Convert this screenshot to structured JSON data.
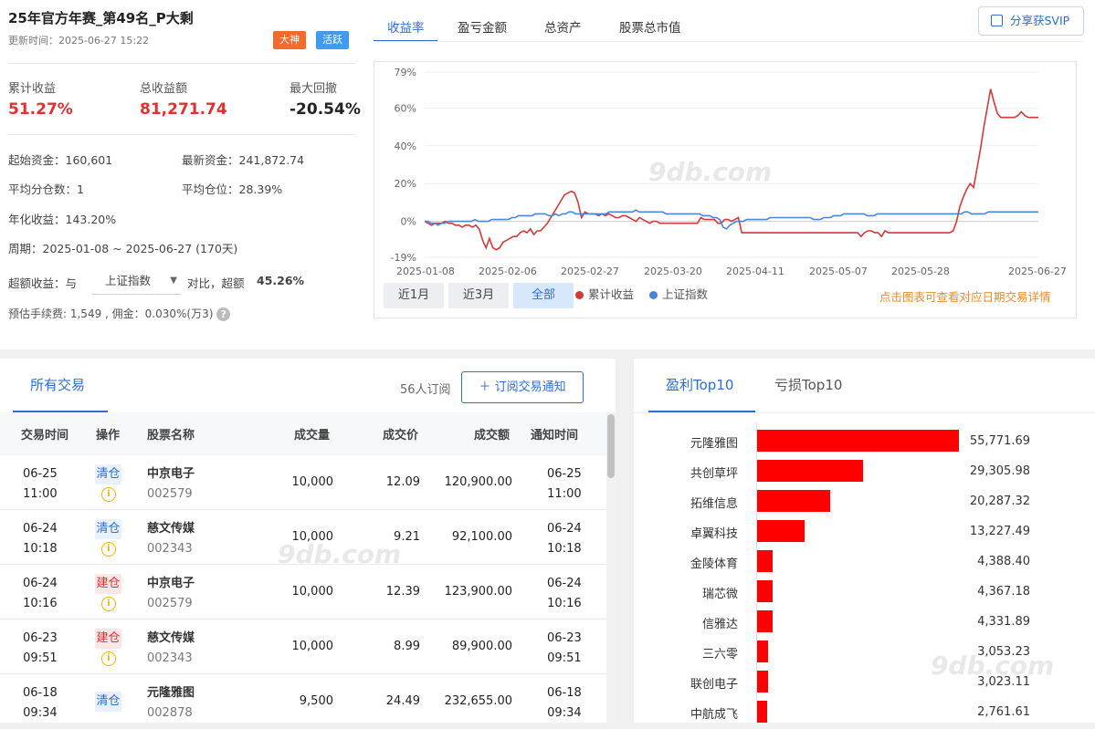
{
  "header": {
    "title": "25年官方年赛_第49名_P大剩",
    "updated": "更新时间：2025-06-27 15:22",
    "badges": [
      "大神",
      "活跃"
    ]
  },
  "stats": [
    {
      "label": "累计收益",
      "value": "51.27%"
    },
    {
      "label": "总收益额",
      "value": "81,271.74"
    },
    {
      "label": "最大回撤",
      "value": "-20.54%"
    }
  ],
  "info": {
    "start_capital": "起始资金：160,601",
    "latest_capital": "最新资金：241,872.74",
    "avg_split": "平均分仓数：1",
    "avg_position": "平均仓位：28.39%",
    "annual": "年化收益：143.20%",
    "period": "周期：2025-01-08 ~ 2025-06-27 (170天)",
    "excess_prefix": "超额收益：与",
    "excess_select": "上证指数",
    "excess_mid": "对比，超额",
    "excess_value": "45.26%",
    "fee": "预估手续费: 1,549 , 佣金：0.030%(万3)"
  },
  "chart_tabs": [
    "收益率",
    "盈亏金额",
    "总资产",
    "股票总市值"
  ],
  "share_label": "分享获SVIP",
  "range_buttons": [
    "近1月",
    "近3月",
    "全部"
  ],
  "legend": [
    "累计收益",
    "上证指数"
  ],
  "hint": "点击图表可查看对应日期交易详情",
  "watermark": "9db.com",
  "colors": {
    "series_return": "#d23a3a",
    "series_index": "#4a86d6",
    "accent": "#2d6dd4",
    "bar": "#ff0000"
  },
  "chart_data": {
    "type": "line",
    "x_ticks": [
      "2025-01-08",
      "2025-02-06",
      "2025-02-27",
      "2025-03-20",
      "2025-04-11",
      "2025-05-07",
      "2025-05-28",
      "2025-06-27"
    ],
    "y_ticks": [
      "79%",
      "60%",
      "40%",
      "20%",
      "0%",
      "-19%"
    ],
    "ylim": [
      -19,
      79
    ],
    "grid": "horizontal",
    "series": [
      {
        "name": "累计收益",
        "values": [
          0,
          -1,
          -2,
          -1,
          -1,
          -1,
          0,
          -1,
          -1,
          -2,
          -2,
          -3,
          -2,
          -2,
          -3,
          -2,
          -4,
          -10,
          -14,
          -9,
          -14,
          -15,
          -14,
          -11,
          -10,
          -9,
          -8,
          -8,
          -6,
          -5,
          -6,
          -4,
          -7,
          -5,
          -5,
          -3,
          -1,
          2,
          5,
          8,
          11,
          14,
          15,
          16,
          15,
          10,
          2,
          5,
          4,
          4,
          4,
          3,
          4,
          3,
          4,
          3,
          2,
          2,
          3,
          3,
          2,
          1,
          0,
          2,
          1,
          0,
          -1,
          0,
          0,
          -1,
          -1,
          -1,
          -1,
          -1,
          -1,
          -1,
          -1,
          -1,
          -1,
          -1,
          -1,
          2,
          1,
          1,
          1,
          1,
          -1,
          -1,
          1,
          1,
          0,
          1,
          2,
          -6,
          -6,
          -6,
          -6,
          -6,
          -6,
          -6,
          -6,
          -6,
          -6,
          -6,
          -6,
          -6,
          -6,
          -6,
          -6,
          -6,
          -6,
          -6,
          -6,
          -6,
          -6,
          -6,
          -6,
          -6,
          -6,
          -6,
          -6,
          -6,
          -6,
          -6,
          -6,
          -6,
          -6,
          -6,
          -8,
          -6,
          -5,
          -5,
          -6,
          -6,
          -8,
          -5,
          -6,
          -6,
          -6,
          -6,
          -6,
          -6,
          -6,
          -6,
          -6,
          -6,
          -6,
          -6,
          -6,
          -6,
          -6,
          -6,
          -6,
          -6,
          -6,
          -5,
          0,
          8,
          13,
          17,
          20,
          18,
          28,
          38,
          50,
          60,
          70,
          63,
          57,
          55,
          55,
          55,
          55,
          55,
          56,
          58,
          56,
          55,
          55,
          55,
          55
        ]
      },
      {
        "name": "上证指数",
        "values": [
          0,
          0,
          -1,
          -1,
          -2,
          -1,
          -1,
          0,
          0,
          0,
          0,
          0,
          0,
          0,
          0,
          1,
          0,
          0,
          0,
          0,
          1,
          1,
          1,
          1,
          1,
          1,
          2,
          2,
          3,
          3,
          3,
          3,
          3,
          4,
          4,
          4,
          4,
          3,
          3,
          4,
          3,
          4,
          4,
          5,
          5,
          4,
          4,
          4,
          4,
          4,
          4,
          4,
          4,
          4,
          4,
          5,
          5,
          5,
          5,
          5,
          5,
          5,
          5,
          6,
          5,
          5,
          5,
          5,
          5,
          5,
          5,
          5,
          4,
          4,
          4,
          4,
          4,
          4,
          4,
          4,
          4,
          4,
          4,
          3,
          3,
          3,
          2,
          2,
          1,
          -3,
          -4,
          -2,
          -1,
          0,
          0,
          0,
          1,
          1,
          1,
          1,
          1,
          1,
          1,
          2,
          2,
          2,
          2,
          2,
          2,
          2,
          2,
          2,
          2,
          2,
          2,
          2,
          1,
          1,
          1,
          2,
          2,
          2,
          3,
          3,
          3,
          4,
          4,
          4,
          4,
          4,
          4,
          4,
          3,
          3,
          3,
          4,
          4,
          4,
          4,
          4,
          4,
          4,
          4,
          4,
          4,
          4,
          4,
          4,
          4,
          4,
          4,
          4,
          4,
          4,
          4,
          4,
          4,
          4,
          4,
          4,
          4,
          5,
          5,
          4,
          4,
          4,
          4,
          4,
          5,
          5,
          5,
          5,
          5,
          5,
          5,
          5,
          5,
          5,
          5,
          5,
          5,
          5,
          5,
          5
        ]
      }
    ]
  },
  "trades": {
    "tab": "所有交易",
    "subscribers": "56人订阅",
    "subscribe_btn": "订阅交易通知",
    "headers": [
      "交易时间",
      "操作",
      "股票名称",
      "成交量",
      "成交价",
      "成交额",
      "通知时间"
    ],
    "rows": [
      {
        "date": "06-25",
        "time": "11:00",
        "op": "清仓",
        "name": "中京电子",
        "code": "002579",
        "vol": "10,000",
        "price": "12.09",
        "amount": "120,900.00",
        "ndate": "06-25",
        "ntime": "11:00"
      },
      {
        "date": "06-24",
        "time": "10:18",
        "op": "清仓",
        "name": "慈文传媒",
        "code": "002343",
        "vol": "10,000",
        "price": "9.21",
        "amount": "92,100.00",
        "ndate": "06-24",
        "ntime": "10:18"
      },
      {
        "date": "06-24",
        "time": "10:16",
        "op": "建仓",
        "name": "中京电子",
        "code": "002579",
        "vol": "10,000",
        "price": "12.39",
        "amount": "123,900.00",
        "ndate": "06-24",
        "ntime": "10:16"
      },
      {
        "date": "06-23",
        "time": "09:51",
        "op": "建仓",
        "name": "慈文传媒",
        "code": "002343",
        "vol": "10,000",
        "price": "8.99",
        "amount": "89,900.00",
        "ndate": "06-23",
        "ntime": "09:51"
      },
      {
        "date": "06-18",
        "time": "09:34",
        "op": "清仓",
        "name": "元隆雅图",
        "code": "002878",
        "vol": "9,500",
        "price": "24.49",
        "amount": "232,655.00",
        "ndate": "06-18",
        "ntime": "09:34"
      }
    ]
  },
  "top10": {
    "tabs": [
      "盈利Top10",
      "亏损Top10"
    ],
    "chart_data": {
      "type": "bar",
      "categories": [
        "元隆雅图",
        "共创草坪",
        "拓维信息",
        "卓翼科技",
        "金陵体育",
        "瑞芯微",
        "信雅达",
        "三六零",
        "联创电子",
        "中航成飞"
      ],
      "values": [
        55771.69,
        29305.98,
        20287.32,
        13227.49,
        4388.4,
        4367.18,
        4331.89,
        3053.23,
        3023.11,
        2761.61
      ],
      "labels": [
        "55,771.69",
        "29,305.98",
        "20,287.32",
        "13,227.49",
        "4,388.40",
        "4,367.18",
        "4,331.89",
        "3,053.23",
        "3,023.11",
        "2,761.61"
      ]
    }
  }
}
